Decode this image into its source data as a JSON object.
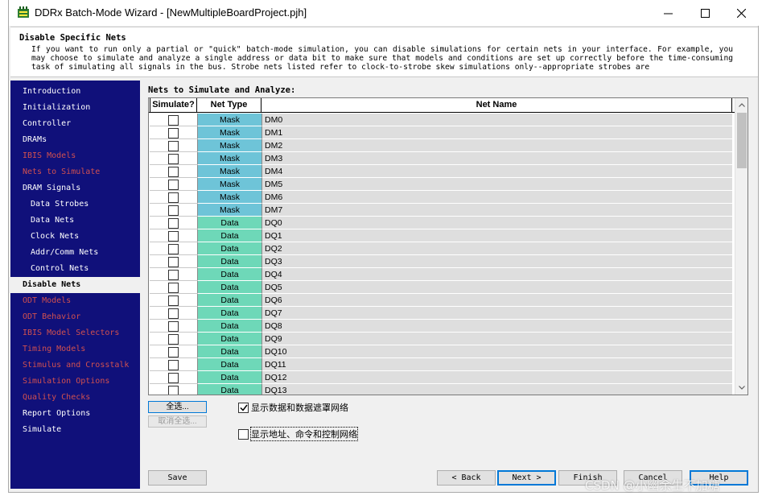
{
  "window": {
    "title": "DDRx Batch-Mode Wizard - [NewMultipleBoardProject.pjh]",
    "icon": "wizard-app-icon",
    "controls": [
      "minimize-icon",
      "maximize-icon",
      "close-icon"
    ]
  },
  "header": {
    "title": "Disable Specific Nets",
    "description": "If you want to run only a partial or \"quick\" batch-mode simulation, you can disable simulations for certain nets in your interface. For example, you may choose to simulate and analyze a single address or data bit to make sure that models and conditions are set up correctly before the time-consuming task of simulating all signals in the bus. Strobe nets listed refer to clock-to-strobe skew simulations only--appropriate strobes are"
  },
  "sidebar": {
    "items": [
      {
        "label": "Introduction",
        "state": "done",
        "indent": 0
      },
      {
        "label": "Initialization",
        "state": "done",
        "indent": 0
      },
      {
        "label": "Controller",
        "state": "done",
        "indent": 0
      },
      {
        "label": "DRAMs",
        "state": "done",
        "indent": 0
      },
      {
        "label": "IBIS Models",
        "state": "todo",
        "indent": 0
      },
      {
        "label": "Nets to Simulate",
        "state": "todo",
        "indent": 0
      },
      {
        "label": "DRAM Signals",
        "state": "done",
        "indent": 0
      },
      {
        "label": "Data Strobes",
        "state": "done",
        "indent": 1
      },
      {
        "label": "Data Nets",
        "state": "done",
        "indent": 1
      },
      {
        "label": "Clock Nets",
        "state": "done",
        "indent": 1
      },
      {
        "label": "Addr/Comm Nets",
        "state": "done",
        "indent": 1
      },
      {
        "label": "Control Nets",
        "state": "done",
        "indent": 1
      },
      {
        "label": "Disable Nets",
        "state": "active",
        "indent": 0
      },
      {
        "label": "ODT Models",
        "state": "todo",
        "indent": 0
      },
      {
        "label": "ODT Behavior",
        "state": "todo",
        "indent": 0
      },
      {
        "label": "IBIS Model Selectors",
        "state": "todo",
        "indent": 0
      },
      {
        "label": "Timing Models",
        "state": "todo",
        "indent": 0
      },
      {
        "label": "Stimulus and Crosstalk",
        "state": "todo",
        "indent": 0
      },
      {
        "label": "Simulation Options",
        "state": "todo",
        "indent": 0
      },
      {
        "label": "Quality Checks",
        "state": "todo",
        "indent": 0
      },
      {
        "label": "Report Options",
        "state": "done",
        "indent": 0
      },
      {
        "label": "Simulate",
        "state": "done",
        "indent": 0
      }
    ],
    "colors": {
      "background": "#10107a",
      "done": "#ffffff",
      "todo": "#d05050"
    }
  },
  "main": {
    "section_title": "Nets to Simulate and Analyze:",
    "columns": [
      "Simulate?",
      "Net Type",
      "Net Name"
    ],
    "rows": [
      {
        "simulate": false,
        "type": "Mask",
        "name": "DM0"
      },
      {
        "simulate": false,
        "type": "Mask",
        "name": "DM1"
      },
      {
        "simulate": false,
        "type": "Mask",
        "name": "DM2"
      },
      {
        "simulate": false,
        "type": "Mask",
        "name": "DM3"
      },
      {
        "simulate": false,
        "type": "Mask",
        "name": "DM4"
      },
      {
        "simulate": false,
        "type": "Mask",
        "name": "DM5"
      },
      {
        "simulate": false,
        "type": "Mask",
        "name": "DM6"
      },
      {
        "simulate": false,
        "type": "Mask",
        "name": "DM7"
      },
      {
        "simulate": false,
        "type": "Data",
        "name": "DQ0"
      },
      {
        "simulate": false,
        "type": "Data",
        "name": "DQ1"
      },
      {
        "simulate": false,
        "type": "Data",
        "name": "DQ2"
      },
      {
        "simulate": false,
        "type": "Data",
        "name": "DQ3"
      },
      {
        "simulate": false,
        "type": "Data",
        "name": "DQ4"
      },
      {
        "simulate": false,
        "type": "Data",
        "name": "DQ5"
      },
      {
        "simulate": false,
        "type": "Data",
        "name": "DQ6"
      },
      {
        "simulate": false,
        "type": "Data",
        "name": "DQ7"
      },
      {
        "simulate": false,
        "type": "Data",
        "name": "DQ8"
      },
      {
        "simulate": false,
        "type": "Data",
        "name": "DQ9"
      },
      {
        "simulate": false,
        "type": "Data",
        "name": "DQ10"
      },
      {
        "simulate": false,
        "type": "Data",
        "name": "DQ11"
      },
      {
        "simulate": false,
        "type": "Data",
        "name": "DQ12"
      },
      {
        "simulate": false,
        "type": "Data",
        "name": "DQ13"
      }
    ],
    "type_colors": {
      "Mask": "#6ec4d8",
      "Data": "#6ed8b8"
    },
    "select_all_label": "全选...",
    "deselect_all_label": "取消全选...",
    "show_data_nets": {
      "label": "显示数据和数据遮罩网络",
      "checked": true
    },
    "show_addr_nets": {
      "label": "显示地址、命令和控制网络",
      "checked": false
    }
  },
  "footer": {
    "save": "Save",
    "back": "< Back",
    "next": "Next >",
    "finish": "Finish",
    "cancel": "Cancel",
    "help": "Help"
  },
  "watermark": "CSDN @小幽余生不加糖"
}
